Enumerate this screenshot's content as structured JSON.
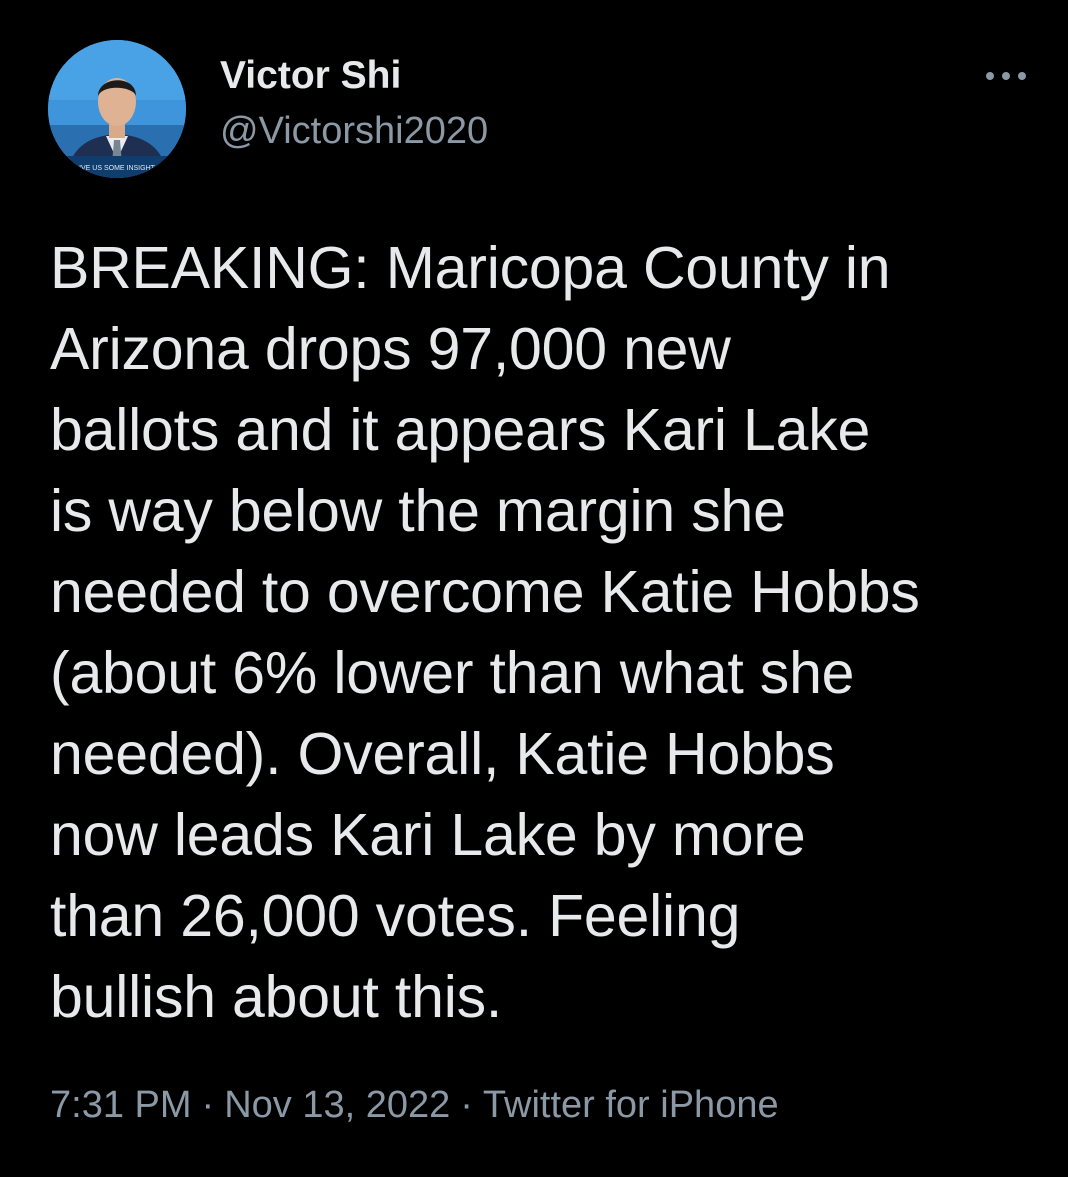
{
  "user": {
    "display_name": "Victor Shi",
    "handle": "@Victorshi2020",
    "avatar_icon": "profile-photo-avatar",
    "avatar_caption": "IVE US SOME INSIGHT"
  },
  "more_icon": "more-dots-icon",
  "tweet": {
    "text": "BREAKING: Maricopa County in\nArizona drops 97,000 new\nballots and it appears Kari Lake\nis way below the margin she\nneeded to overcome Katie Hobbs\n(about 6% lower than what she\nneeded). Overall, Katie Hobbs\nnow leads Kari Lake by more\nthan 26,000 votes. Feeling\nbullish about this.",
    "time": "7:31 PM",
    "separator": "·",
    "date": "Nov 13, 2022",
    "source": "Twitter for iPhone"
  },
  "colors": {
    "background": "#000000",
    "primary_text": "#e7e9ea",
    "secondary_text": "#8b98a5",
    "avatar_bg": "#3a8fd6"
  }
}
